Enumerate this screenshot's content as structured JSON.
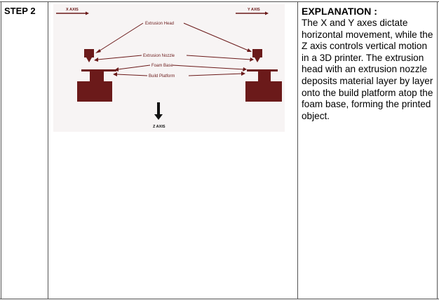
{
  "step": {
    "label": "STEP 2"
  },
  "diagram": {
    "x_axis_label": "X AXIS",
    "y_axis_label": "Y AXIS",
    "z_axis_label": "Z AXIS",
    "labels": [
      "Extrusion Head",
      "Extrusion Nozzle",
      "Foam Base",
      "Build Platform"
    ],
    "color": "#6b1a1a"
  },
  "explanation": {
    "title": "EXPLANATION :",
    "body": "The X and Y axes dictate horizontal movement, while the Z axis controls vertical motion in a 3D printer. The extrusion head with an extrusion nozzle deposits material layer by layer onto the build platform atop the foam base, forming the printed object."
  }
}
